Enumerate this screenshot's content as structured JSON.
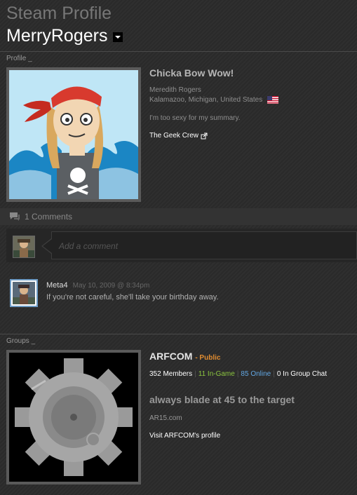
{
  "header": {
    "app_title": "Steam Profile",
    "username": "MerryRogers"
  },
  "profile": {
    "section_label": "Profile _",
    "display_name": "Chicka Bow Wow!",
    "real_name": "Meredith Rogers",
    "location": "Kalamazoo, Michigan, United States",
    "summary": "I'm too sexy for my summary.",
    "link_text": "The Geek Crew"
  },
  "comments": {
    "count_label": "1 Comments",
    "input_placeholder": "Add a comment",
    "items": [
      {
        "author": "Meta4",
        "date": "May 10, 2009 @ 8:34pm",
        "text": "If you're not careful, she'll take your birthday away."
      }
    ]
  },
  "groups": {
    "section_label": "Groups _",
    "name": "ARFCOM",
    "visibility": "- Public",
    "members": "352 Members",
    "in_game": "11 In-Game",
    "online": "85 Online",
    "in_chat": "0 In Group Chat",
    "headline": "always blade at 45 to the target",
    "url": "AR15.com",
    "visit_label": "Visit ARFCOM's profile"
  },
  "colors": {
    "public_orange": "#e08c31",
    "ingame_green": "#8bc53f",
    "online_blue": "#62a7e3",
    "comment_avatar_border": "#6d9bc5"
  }
}
